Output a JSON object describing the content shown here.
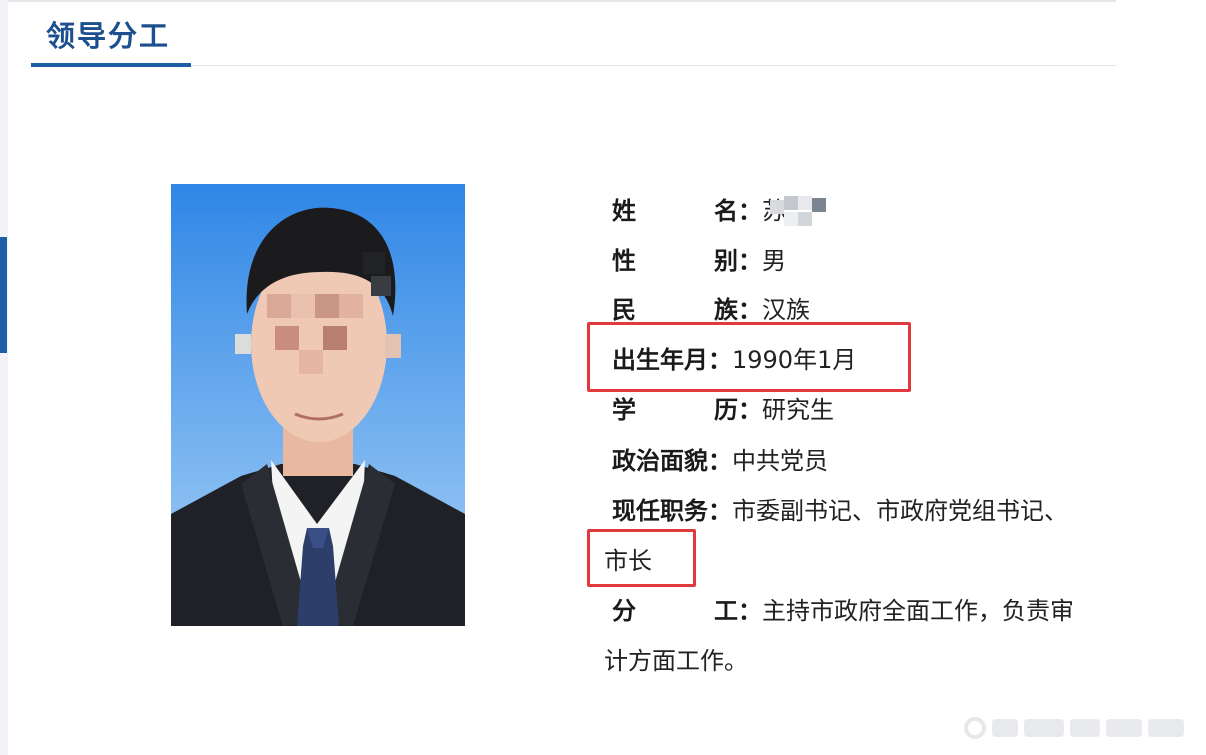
{
  "section": {
    "title": "领导分工"
  },
  "photo": {
    "description_icon": "portrait-photo"
  },
  "profile": {
    "name": {
      "label": "姓名",
      "colon": "：",
      "value": "苏"
    },
    "gender": {
      "label": "性别",
      "colon": "：",
      "value": "男"
    },
    "ethnicity": {
      "label": "民族",
      "colon": "：",
      "value": "汉族"
    },
    "birth": {
      "label": "出生年月",
      "colon": "：",
      "value": "1990年1月"
    },
    "education": {
      "label": "学历",
      "colon": "：",
      "value": "研究生"
    },
    "politics": {
      "label": "政治面貌",
      "colon": "：",
      "value": "中共党员"
    },
    "position": {
      "label": "现任职务",
      "colon": "：",
      "value": "市委副书记、市政府党组书记、",
      "value_cont": "市长"
    },
    "duty": {
      "label": "分工",
      "colon": "：",
      "value": "主持市政府全面工作，负责审",
      "value_cont": "计方面工作。"
    }
  },
  "colors": {
    "accent": "#1c5fa6",
    "title": "#1c4f8e",
    "highlight": "#e0393e",
    "photo_background": "#3b8ee8"
  }
}
